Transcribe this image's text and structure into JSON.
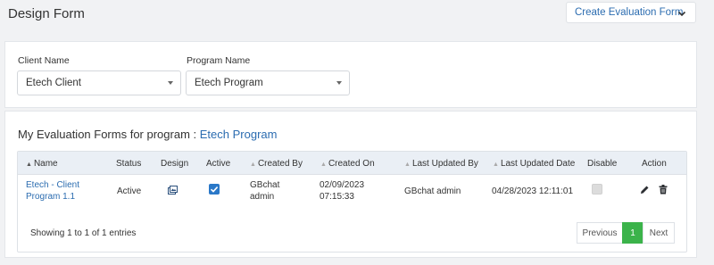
{
  "header": {
    "title": "Design Form",
    "create_button": "Create Evaluation Form"
  },
  "filters": {
    "client": {
      "label": "Client Name",
      "value": "Etech Client"
    },
    "program": {
      "label": "Program Name",
      "value": "Etech Program"
    }
  },
  "forms": {
    "heading_prefix": "My Evaluation Forms for program :",
    "program": "Etech Program",
    "columns": [
      "Name",
      "Status",
      "Design",
      "Active",
      "Created By",
      "Created On",
      "Last Updated By",
      "Last Updated Date",
      "Disable",
      "Action"
    ],
    "rows": [
      {
        "name": "Etech - Client Program 1.1",
        "status": "Active",
        "active": true,
        "created_by": "GBchat admin",
        "created_on": "02/09/2023 07:15:33",
        "last_updated_by": "GBchat admin",
        "last_updated_date": "04/28/2023 12:11:01",
        "disabled": false
      }
    ],
    "summary": "Showing 1 to 1 of 1 entries",
    "pagination": {
      "previous": "Previous",
      "current": "1",
      "next": "Next"
    }
  },
  "colors": {
    "accent": "#2b6cb0",
    "checkbox": "#2a78c8",
    "page_active": "#3bb34a"
  }
}
